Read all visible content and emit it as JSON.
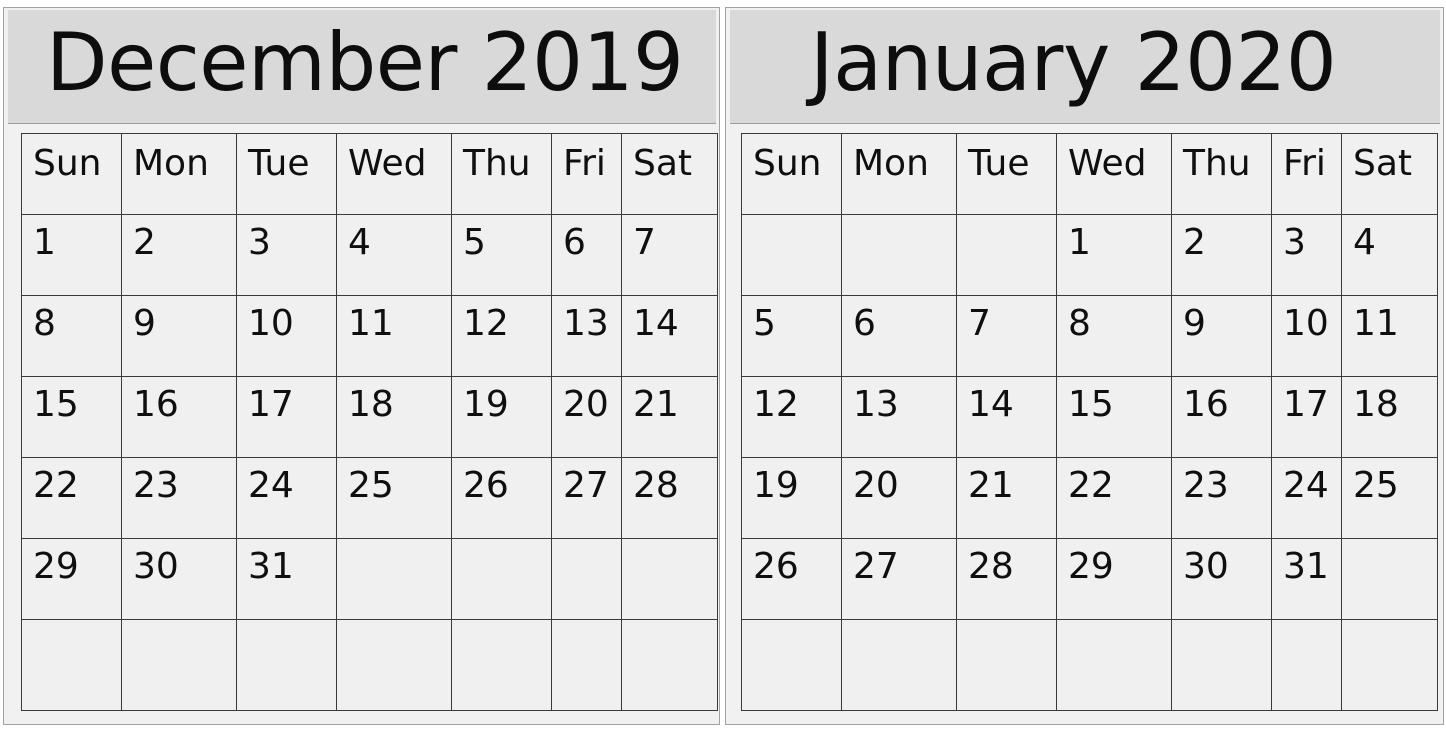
{
  "page": {
    "background_color": "#ffffff",
    "frame_border_color": "#9a9a9a",
    "panel_color": "#f2f2f2",
    "cell_color": "#f0f0f0",
    "header_band_color": "#d9d9d9",
    "grid_line_color": "#3a3a3a",
    "text_color": "#0f0f0f"
  },
  "weekday_headers": [
    "Sun",
    "Mon",
    "Tue",
    "Wed",
    "Thu",
    "Fri",
    "Sat"
  ],
  "months": [
    {
      "id": "december-2019",
      "title": "December 2019",
      "month_name": "December",
      "year": "2019",
      "weeks": [
        [
          "1",
          "2",
          "3",
          "4",
          "5",
          "6",
          "7"
        ],
        [
          "8",
          "9",
          "10",
          "11",
          "12",
          "13",
          "14"
        ],
        [
          "15",
          "16",
          "17",
          "18",
          "19",
          "20",
          "21"
        ],
        [
          "22",
          "23",
          "24",
          "25",
          "26",
          "27",
          "28"
        ],
        [
          "29",
          "30",
          "31",
          "",
          "",
          "",
          ""
        ],
        [
          "",
          "",
          "",
          "",
          "",
          "",
          ""
        ]
      ]
    },
    {
      "id": "january-2020",
      "title": "January 2020",
      "month_name": "January",
      "year": "2020",
      "weeks": [
        [
          "",
          "",
          "",
          "1",
          "2",
          "3",
          "4"
        ],
        [
          "5",
          "6",
          "7",
          "8",
          "9",
          "10",
          "11"
        ],
        [
          "12",
          "13",
          "14",
          "15",
          "16",
          "17",
          "18"
        ],
        [
          "19",
          "20",
          "21",
          "22",
          "23",
          "24",
          "25"
        ],
        [
          "26",
          "27",
          "28",
          "29",
          "30",
          "31",
          ""
        ],
        [
          "",
          "",
          "",
          "",
          "",
          "",
          ""
        ]
      ]
    }
  ]
}
